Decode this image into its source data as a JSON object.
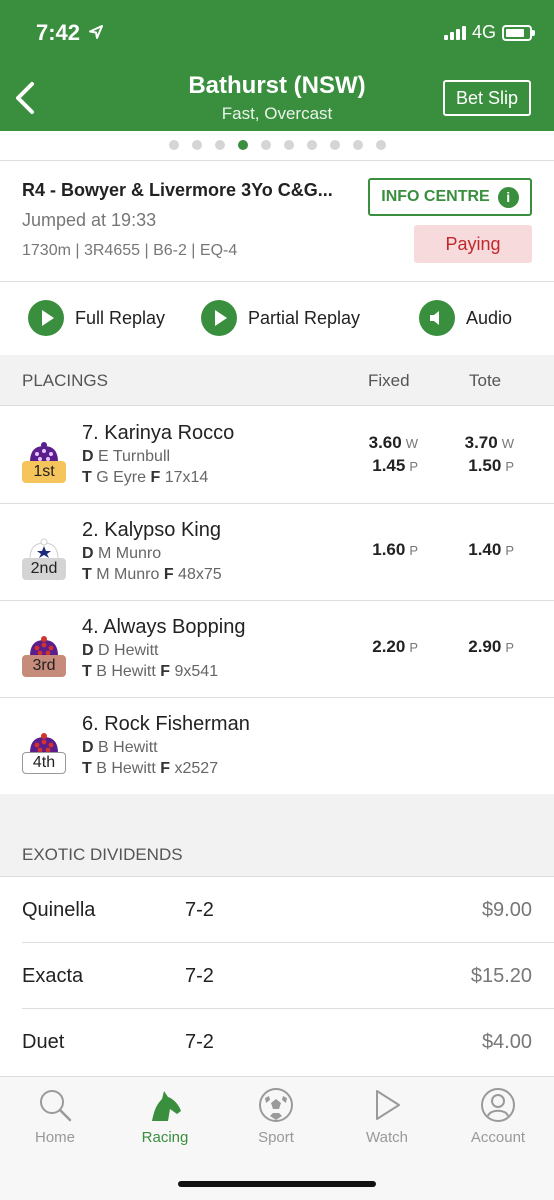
{
  "status": {
    "time": "7:42",
    "network": "4G"
  },
  "header": {
    "title": "Bathurst (NSW)",
    "subtitle": "Fast, Overcast",
    "bet_slip": "Bet Slip"
  },
  "pager": {
    "count": 10,
    "active_index": 3
  },
  "race": {
    "name": "R4 - Bowyer & Livermore 3Yo C&G...",
    "jumped": "Jumped at 19:33",
    "meta": "1730m | 3R4655 | B6-2 | EQ-4",
    "info_centre": "INFO CENTRE",
    "status": "Paying"
  },
  "replays": {
    "full": "Full Replay",
    "partial": "Partial Replay",
    "audio": "Audio"
  },
  "placings": {
    "heading": "PLACINGS",
    "col_fixed": "Fixed",
    "col_tote": "Tote",
    "runners": [
      {
        "name": "7. Karinya Rocco",
        "d_label": "D",
        "driver": "E Turnbull",
        "t_label": "T",
        "trainer": "G Eyre",
        "f_label": "F",
        "form": "17x14",
        "place": "1st",
        "badge_color": "#f5c55b",
        "fixed_w": "3.60",
        "fixed_p": "1.45",
        "tote_w": "3.70",
        "tote_p": "1.50",
        "w_label": "W",
        "p_label": "P"
      },
      {
        "name": "2. Kalypso King",
        "d_label": "D",
        "driver": "M Munro",
        "t_label": "T",
        "trainer": "M Munro",
        "f_label": "F",
        "form": "48x75",
        "place": "2nd",
        "badge_color": "#d4d4d4",
        "fixed_p": "1.60",
        "tote_p": "1.40",
        "p_label": "P"
      },
      {
        "name": "4. Always Bopping",
        "d_label": "D",
        "driver": "D Hewitt",
        "t_label": "T",
        "trainer": "B Hewitt",
        "f_label": "F",
        "form": "9x541",
        "place": "3rd",
        "badge_color": "#c78b7b",
        "fixed_p": "2.20",
        "tote_p": "2.90",
        "p_label": "P"
      },
      {
        "name": "6. Rock Fisherman",
        "d_label": "D",
        "driver": "B Hewitt",
        "t_label": "T",
        "trainer": "B Hewitt",
        "f_label": "F",
        "form": "x2527",
        "place": "4th",
        "badge_color": "#ffffff"
      }
    ]
  },
  "exotics": {
    "heading": "EXOTIC DIVIDENDS",
    "rows": [
      {
        "name": "Quinella",
        "combination": "7-2",
        "dividend": "$9.00"
      },
      {
        "name": "Exacta",
        "combination": "7-2",
        "dividend": "$15.20"
      },
      {
        "name": "Duet",
        "combination": "7-2",
        "dividend": "$4.00"
      }
    ]
  },
  "tabs": [
    {
      "label": "Home",
      "icon": "search-icon"
    },
    {
      "label": "Racing",
      "icon": "horse-head-icon",
      "active": true
    },
    {
      "label": "Sport",
      "icon": "soccer-ball-icon"
    },
    {
      "label": "Watch",
      "icon": "play-icon"
    },
    {
      "label": "Account",
      "icon": "user-icon"
    }
  ],
  "colors": {
    "brand_green": "#3a8f3e",
    "paying_bg": "#f7dadb",
    "paying_text": "#c0282d"
  }
}
